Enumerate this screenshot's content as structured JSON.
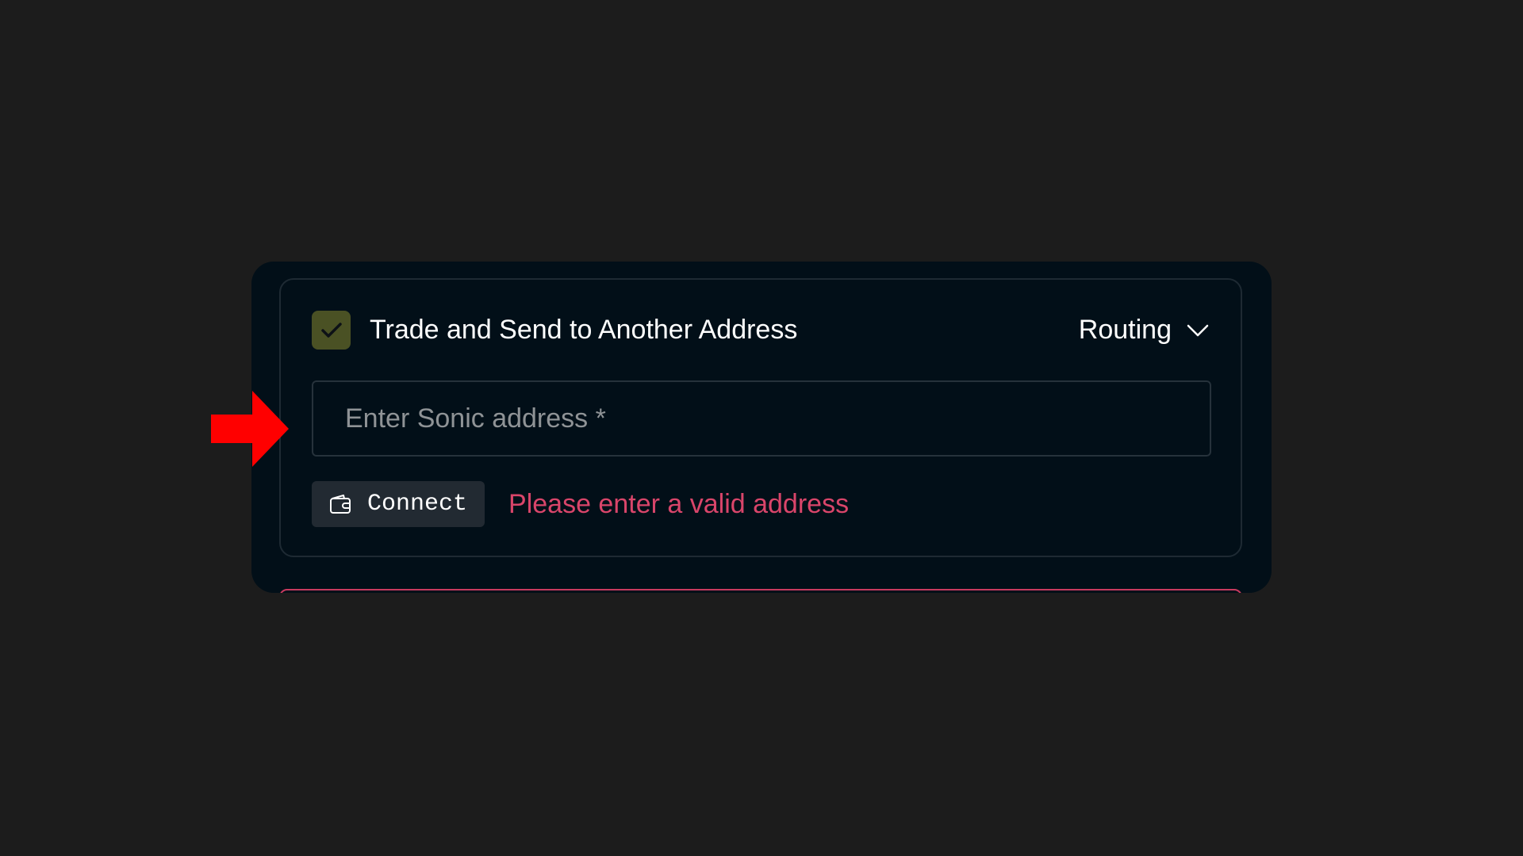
{
  "panel": {
    "checkbox_checked": true,
    "checkbox_color": "#4a5124",
    "title": "Trade and Send to Another Address",
    "routing_label": "Routing",
    "address_input": {
      "value": "",
      "placeholder": "Enter Sonic address *"
    },
    "connect_label": "Connect",
    "error_message": "Please enter a valid address",
    "error_color": "#d9456a"
  },
  "icons": {
    "checkbox": "check-icon",
    "routing": "chevron-down-icon",
    "connect": "wallet-icon",
    "annotation": "red-arrow-pointer"
  }
}
